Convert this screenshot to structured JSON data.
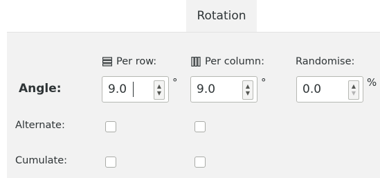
{
  "tab": {
    "label": "Rotation"
  },
  "columns": {
    "per_row": {
      "label": "Per row:",
      "icon": "rows-icon"
    },
    "per_column": {
      "label": "Per column:",
      "icon": "columns-icon"
    },
    "randomise": {
      "label": "Randomise:"
    }
  },
  "angle": {
    "label": "Angle:",
    "per_row_value": "9.0",
    "per_row_unit": "°",
    "per_column_value": "9.0",
    "per_column_unit": "°",
    "randomise_value": "0.0",
    "randomise_unit": "%"
  },
  "alternate": {
    "label": "Alternate:",
    "per_row_checked": false,
    "per_column_checked": false
  },
  "cumulate": {
    "label": "Cumulate:",
    "per_row_checked": false,
    "per_column_checked": false
  }
}
